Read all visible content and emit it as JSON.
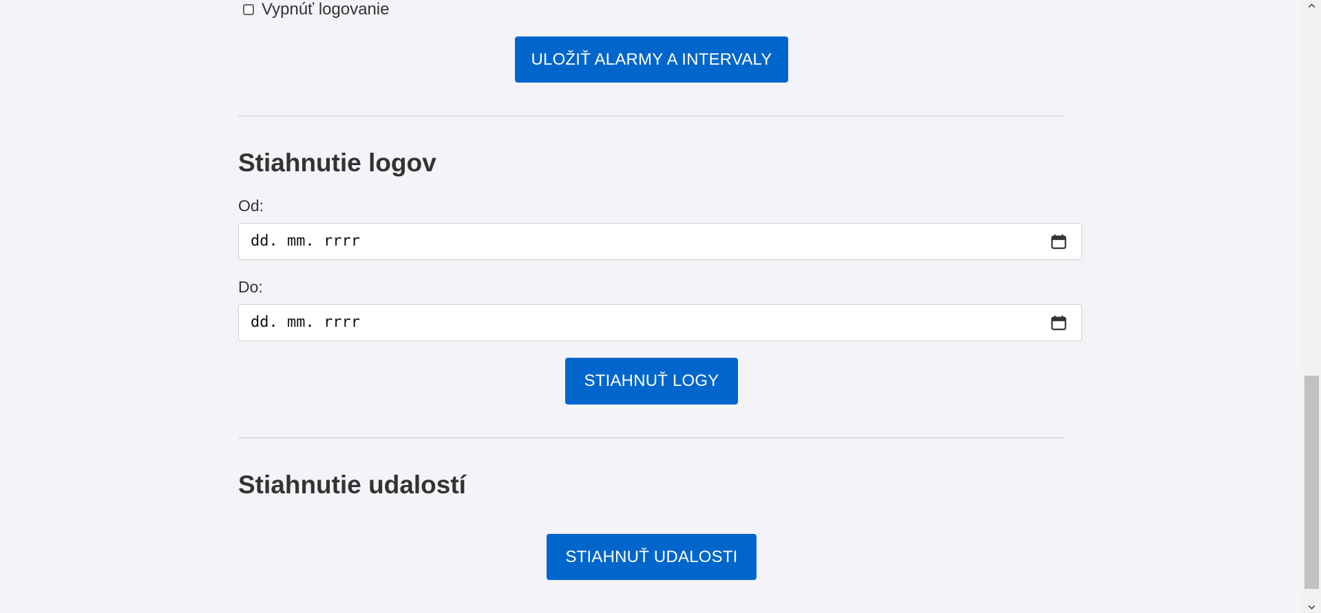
{
  "settings": {
    "disable_logging_label": "Vypnúť logovanie",
    "disable_logging_checked": false,
    "save_button_label": "ULOŽIŤ ALARMY A INTERVALY"
  },
  "logs_section": {
    "title": "Stiahnutie logov",
    "from_label": "Od:",
    "from_value": "dd. mm. rrrr",
    "to_label": "Do:",
    "to_value": "dd. mm. rrrr",
    "download_button_label": "STIAHNUŤ LOGY"
  },
  "events_section": {
    "title": "Stiahnutie udalostí",
    "download_button_label": "STIAHNUŤ UDALOSTI"
  },
  "icons": {
    "date_picker": "calendar-icon",
    "scroll_up": "chevron-up-icon",
    "scroll_down": "chevron-down-icon"
  },
  "colors": {
    "accent": "#0066cc",
    "background": "#f3f3f8",
    "text": "#333333"
  }
}
